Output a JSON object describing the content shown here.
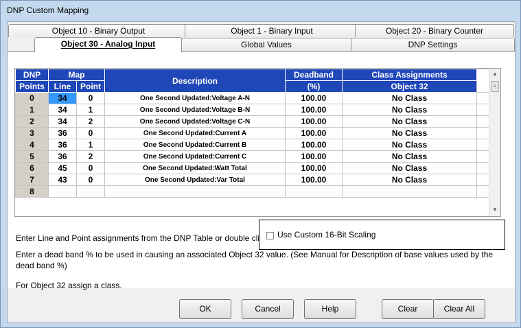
{
  "window": {
    "title": "DNP Custom Mapping"
  },
  "tabs": {
    "row1": [
      "Object 10 - Binary Output",
      "Object 1 - Binary Input",
      "Object 20 - Binary Counter"
    ],
    "row2": [
      "Object 30 - Analog Input",
      "Global Values",
      "DNP Settings"
    ],
    "active": "Object 30 - Analog Input"
  },
  "table": {
    "header": {
      "dnp_top": "DNP",
      "dnp_bottom": "Points",
      "map": "Map",
      "line": "Line",
      "point": "Point",
      "description": "Description",
      "deadband_top": "Deadband",
      "deadband_bottom": "(%)",
      "class_top": "Class Assignments",
      "class_bottom": "Object 32"
    },
    "rows": [
      {
        "dnp": "0",
        "line": "34",
        "point": "0",
        "description": "One Second Updated:Voltage A-N",
        "deadband": "100.00",
        "class": "No Class"
      },
      {
        "dnp": "1",
        "line": "34",
        "point": "1",
        "description": "One Second Updated:Voltage B-N",
        "deadband": "100.00",
        "class": "No Class"
      },
      {
        "dnp": "2",
        "line": "34",
        "point": "2",
        "description": "One Second Updated:Voltage C-N",
        "deadband": "100.00",
        "class": "No Class"
      },
      {
        "dnp": "3",
        "line": "36",
        "point": "0",
        "description": "One Second Updated:Current A",
        "deadband": "100.00",
        "class": "No Class"
      },
      {
        "dnp": "4",
        "line": "36",
        "point": "1",
        "description": "One Second Updated:Current B",
        "deadband": "100.00",
        "class": "No Class"
      },
      {
        "dnp": "5",
        "line": "36",
        "point": "2",
        "description": "One Second Updated:Current C",
        "deadband": "100.00",
        "class": "No Class"
      },
      {
        "dnp": "6",
        "line": "45",
        "point": "0",
        "description": "One Second Updated:Watt Total",
        "deadband": "100.00",
        "class": "No Class"
      },
      {
        "dnp": "7",
        "line": "43",
        "point": "0",
        "description": "One Second Updated:Var Total",
        "deadband": "100.00",
        "class": "No Class"
      },
      {
        "dnp": "8",
        "line": "",
        "point": "",
        "description": "",
        "deadband": "",
        "class": ""
      }
    ],
    "selected_color": "#3399ff",
    "header_color": "#1f47b8"
  },
  "info": {
    "line1": "Enter Line and Point assignments from the DNP Table or double click the Description Field for a list of Selections.",
    "line2": "Enter a dead band % to be used in causing an associated Object 32 value. (See Manual for Description of base values used by the dead band %)",
    "line3": "For Object 32 assign a class."
  },
  "scaling": {
    "label": "Use Custom 16-Bit Scaling",
    "checked": false
  },
  "buttons": {
    "ok": "OK",
    "cancel": "Cancel",
    "help": "Help",
    "clear": "Clear",
    "clear_all": "Clear All"
  },
  "icons": {
    "scroll_up": "triangle-up-icon",
    "scroll_down": "triangle-down-icon",
    "scroll_grip": "grip-lines-icon"
  }
}
